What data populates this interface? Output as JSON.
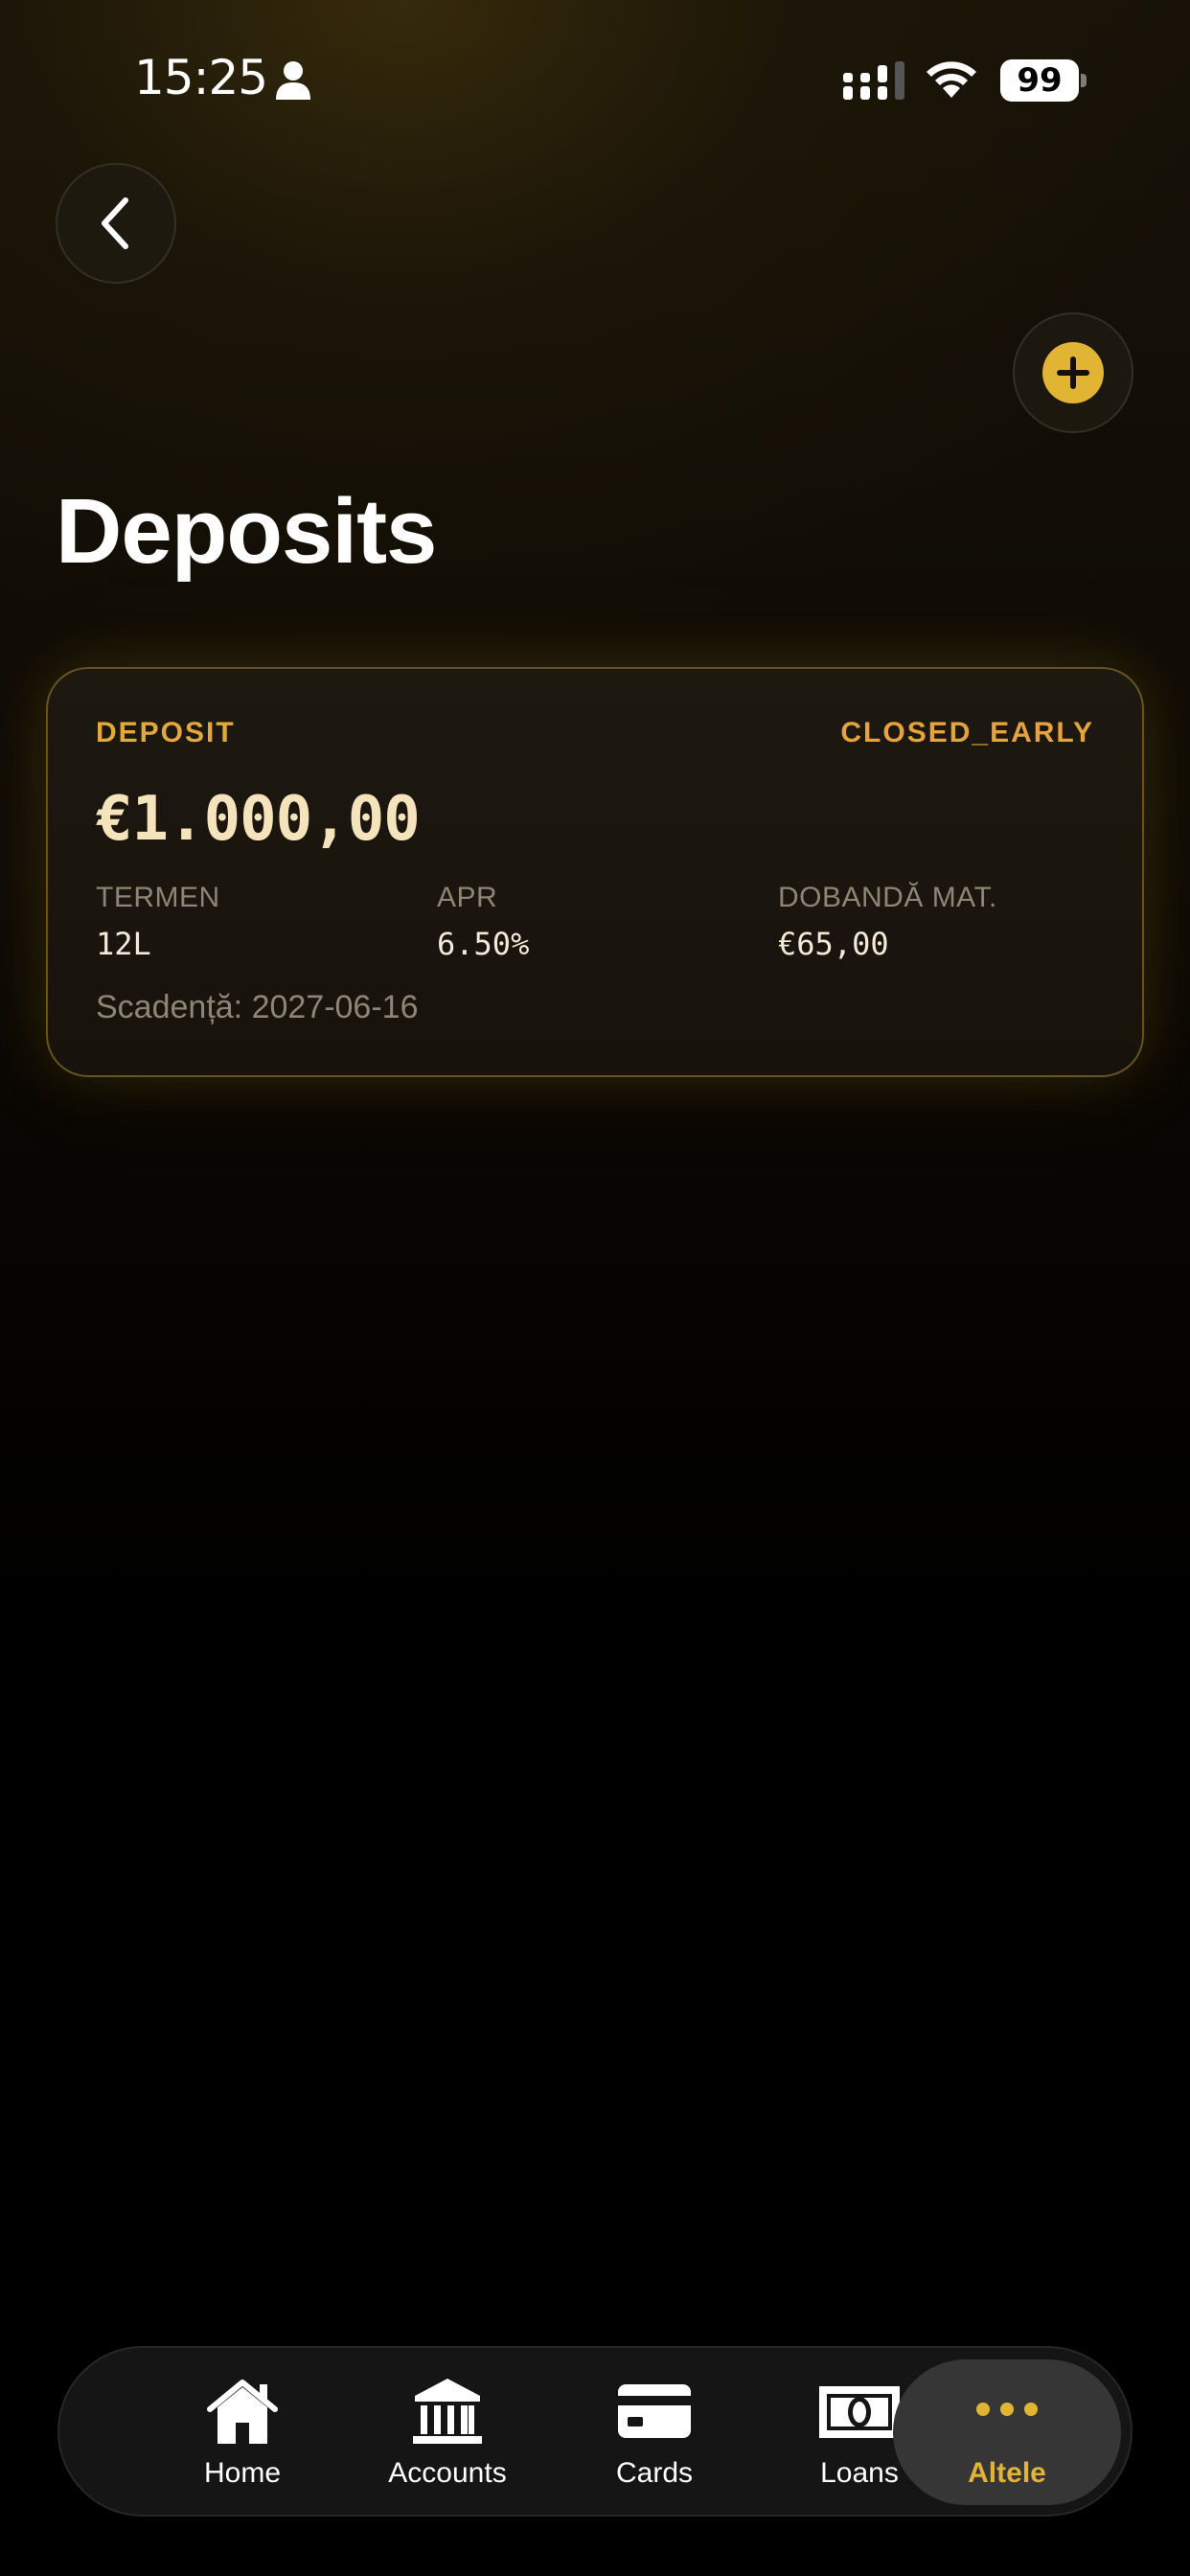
{
  "status_bar": {
    "time": "15:25",
    "battery": "99",
    "icons": [
      "person-icon",
      "cellular-signal-icon",
      "wifi-icon",
      "battery-icon"
    ]
  },
  "header": {
    "back_icon": "chevron-left-icon",
    "add_icon": "plus-circle-icon",
    "title": "Deposits"
  },
  "deposit": {
    "type": "DEPOSIT",
    "status": "CLOSED_EARLY",
    "amount": "€1.000,00",
    "term_label": "TERMEN",
    "term_value": "12L",
    "apr_label": "APR",
    "apr_value": "6.50%",
    "interest_label": "DOBANDĂ MAT.",
    "interest_value": "€65,00",
    "maturity": "Scadență: 2027-06-16"
  },
  "tabs": [
    {
      "label": "Home",
      "icon": "home-icon"
    },
    {
      "label": "Accounts",
      "icon": "bank-icon"
    },
    {
      "label": "Cards",
      "icon": "credit-card-icon"
    },
    {
      "label": "Loans",
      "icon": "banknote-icon"
    },
    {
      "label": "Altele",
      "icon": "more-dots-icon",
      "active": true
    }
  ],
  "colors": {
    "accent": "#e2b433",
    "status": "#e6a23c",
    "amount": "#f5e3bb",
    "muted": "#8e8575"
  }
}
